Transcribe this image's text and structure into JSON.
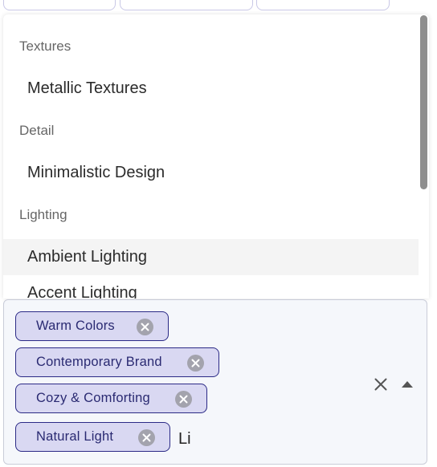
{
  "menu": {
    "groups": [
      {
        "header": "Textures",
        "options": [
          "Metallic Textures"
        ]
      },
      {
        "header": "Detail",
        "options": [
          "Minimalistic Design"
        ]
      },
      {
        "header": "Lighting",
        "options": [
          "Ambient Lighting",
          "Accent Lighting"
        ]
      }
    ],
    "hovered_option": "Ambient Lighting"
  },
  "select": {
    "chips": [
      "Warm Colors",
      "Contemporary Brand",
      "Cozy & Comforting",
      "Natural Light"
    ],
    "input_value": "Li"
  },
  "colors": {
    "chip_bg": "#d9d8f2",
    "chip_border": "#2b2a86",
    "chip_text": "#2a2a72",
    "control_bg": "#f5f7fb",
    "hover_bg": "#f4f4f4"
  },
  "icons": {
    "chip_remove": "circle-x-icon",
    "clear": "close-icon",
    "toggle": "caret-up-icon"
  }
}
